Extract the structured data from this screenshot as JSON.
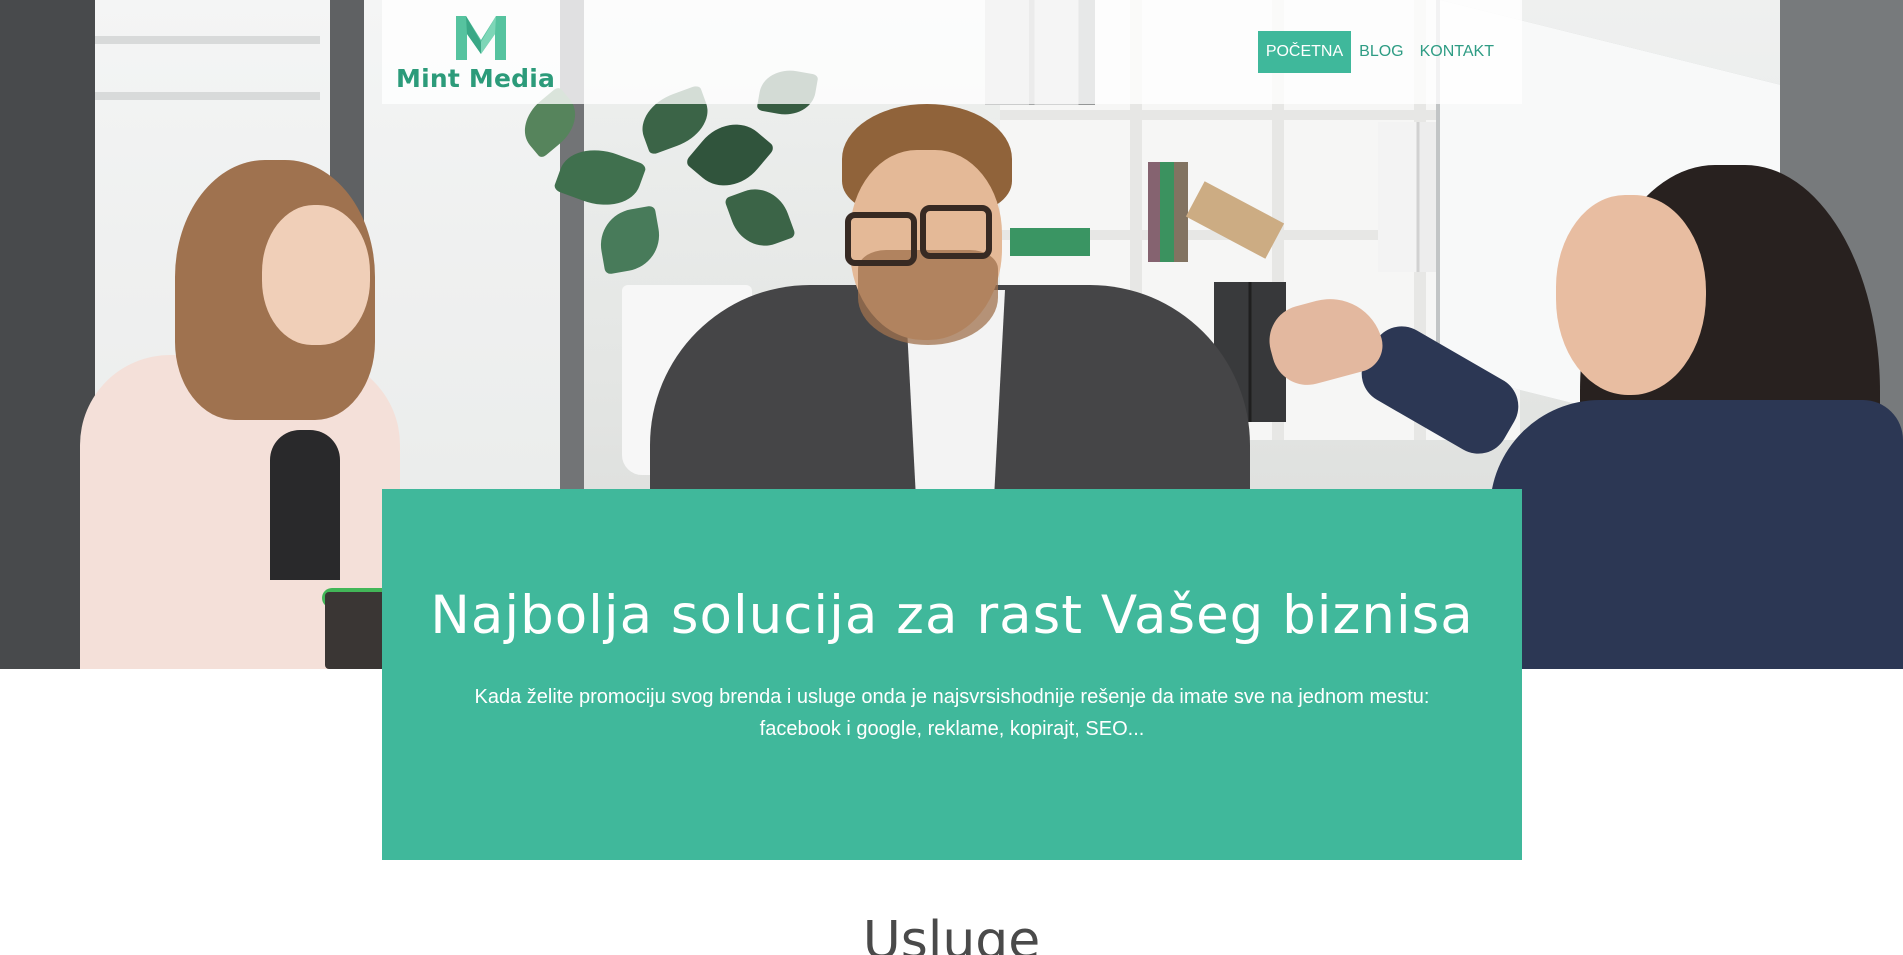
{
  "header": {
    "logo_text": "Mint Media",
    "nav": [
      {
        "label": "POČETNA",
        "active": true
      },
      {
        "label": "BLOG",
        "active": false
      },
      {
        "label": "KONTAKT",
        "active": false
      }
    ]
  },
  "hero": {
    "title": "Najbolja solucija za rast Vašeg biznisa",
    "text": "Kada želite promociju svog brenda i usluge onda je najsvrsishodnije rešenje da imate sve na jednom mestu: facebook i google, reklame, kopirajt, SEO..."
  },
  "services": {
    "title": "Usluge"
  },
  "colors": {
    "brand": "#40b89b",
    "brand_text": "#2c9b7a",
    "heading": "#4a4a4a"
  },
  "icons": {
    "logo": "m-logo-icon"
  }
}
